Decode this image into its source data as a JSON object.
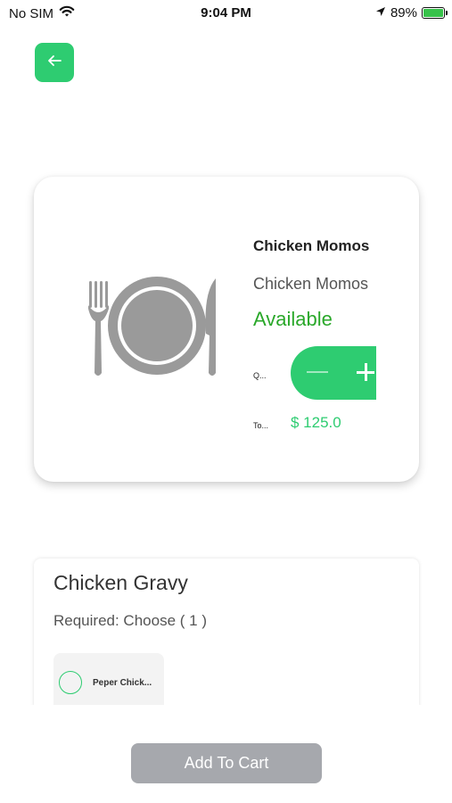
{
  "status_bar": {
    "carrier": "No SIM",
    "time": "9:04 PM",
    "battery": "89%",
    "icons": [
      "wifi-icon",
      "location-arrow-icon",
      "battery-charging-icon"
    ]
  },
  "colors": {
    "accent": "#2ecc71",
    "available": "#2aa82a",
    "button_disabled": "#a6a8ad"
  },
  "header": {
    "back_icon": "arrow-left-icon"
  },
  "product": {
    "image_icon": "plate-fork-knife-icon",
    "title": "Chicken Momos",
    "description": "Chicken Momos",
    "status": "Available",
    "quantity_label": "Q...",
    "total_label": "To...",
    "total_value": "$ 125.0"
  },
  "options": {
    "group_title": "Chicken Gravy",
    "requirement": "Required: Choose ( 1 )",
    "items": [
      {
        "label": "Peper Chick..."
      }
    ]
  },
  "footer": {
    "add_to_cart_label": "Add To Cart"
  }
}
